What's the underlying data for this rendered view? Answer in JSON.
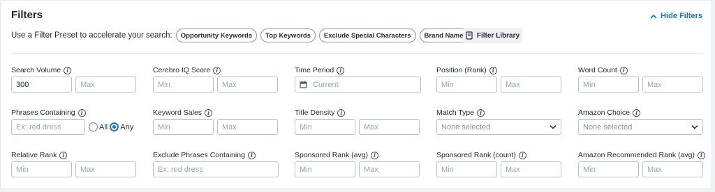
{
  "header": {
    "title": "Filters",
    "hide_label": "Hide Filters"
  },
  "presets": {
    "label": "Use a Filter Preset to accelerate your search:",
    "chips": [
      "Opportunity Keywords",
      "Top Keywords",
      "Exclude Special Characters",
      "Brand Name Removal"
    ],
    "library_label": "Filter Library"
  },
  "fields": {
    "search_volume": {
      "label": "Search Volume",
      "min_value": "300",
      "max_placeholder": "Max"
    },
    "cerebro_iq": {
      "label": "Cerebro IQ Score",
      "min_placeholder": "Min",
      "max_placeholder": "Max"
    },
    "time_period": {
      "label": "Time Period",
      "placeholder": "Current"
    },
    "position_rank": {
      "label": "Position (Rank)",
      "min_placeholder": "Min",
      "max_placeholder": "Max"
    },
    "word_count": {
      "label": "Word Count",
      "min_placeholder": "Min",
      "max_placeholder": "Max"
    },
    "phrases_containing": {
      "label": "Phrases Containing",
      "placeholder": "Ex: red dress",
      "option_all": "All",
      "option_any": "Any",
      "selected": "Any"
    },
    "keyword_sales": {
      "label": "Keyword Sales",
      "min_placeholder": "Min",
      "max_placeholder": "Max"
    },
    "title_density": {
      "label": "Title Density",
      "min_placeholder": "Min",
      "max_placeholder": "Max"
    },
    "match_type": {
      "label": "Match Type",
      "value": "None selected"
    },
    "amazon_choice": {
      "label": "Amazon Choice",
      "value": "None selected"
    },
    "relative_rank": {
      "label": "Relative Rank",
      "min_placeholder": "Min",
      "max_placeholder": "Max"
    },
    "exclude_phrases": {
      "label": "Exclude Phrases Containing",
      "placeholder": "Ex: red dress"
    },
    "sponsored_rank_avg": {
      "label": "Sponsored Rank (avg)",
      "min_placeholder": "Min",
      "max_placeholder": "Max"
    },
    "sponsored_rank_count": {
      "label": "Sponsored Rank (count)",
      "min_placeholder": "Min",
      "max_placeholder": "Max"
    },
    "amazon_recommended_rank": {
      "label": "Amazon Recommended Rank (avg)",
      "min_placeholder": "Min",
      "max_placeholder": "Max"
    }
  },
  "colors": {
    "accent": "#1a73c9",
    "text": "#212b36",
    "border": "#b9c1c9",
    "placeholder": "#9aa3ad"
  },
  "icons": {
    "hide": "chevron-up-icon",
    "library": "book-icon",
    "info": "info-icon",
    "calendar": "calendar-icon",
    "dropdown": "chevron-down-icon"
  }
}
